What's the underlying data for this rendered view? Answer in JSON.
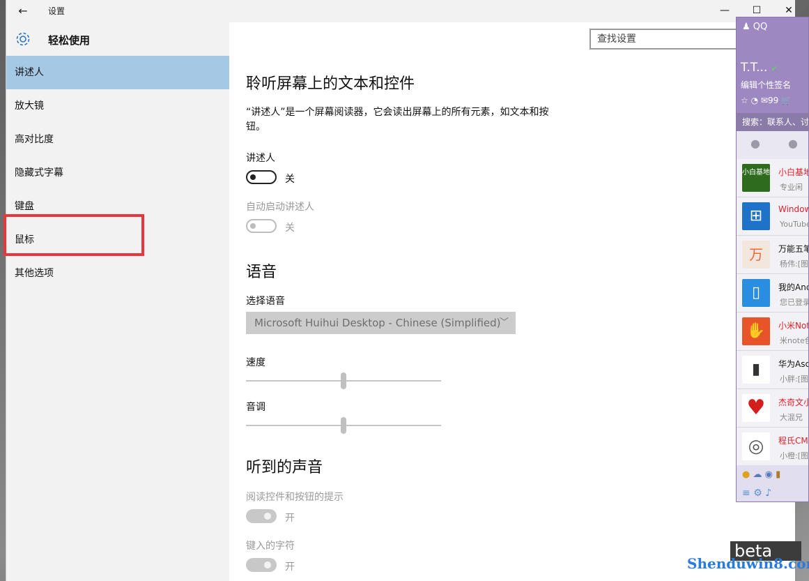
{
  "window": {
    "back_icon": "back-arrow-icon",
    "title": "设置",
    "min_glyph": "—",
    "max_glyph": "☐",
    "close_glyph": "✕"
  },
  "sidebar": {
    "section_title": "轻松使用",
    "items": [
      {
        "label": "讲述人",
        "active": true
      },
      {
        "label": "放大镜"
      },
      {
        "label": "高对比度"
      },
      {
        "label": "隐藏式字幕"
      },
      {
        "label": "键盘"
      },
      {
        "label": "鼠标",
        "highlighted": true
      },
      {
        "label": "其他选项"
      }
    ]
  },
  "search": {
    "placeholder": "查找设置"
  },
  "main": {
    "heading": "聆听屏幕上的文本和控件",
    "description": "“讲述人”是一个屏幕阅读器，它会读出屏幕上的所有元素，如文本和按钮。",
    "narrator_label": "讲述人",
    "narrator_state": "关",
    "autostart_label": "自动启动讲述人",
    "autostart_state": "关",
    "voice_heading": "语音",
    "choose_voice_label": "选择语音",
    "voice_value": "Microsoft Huihui Desktop - Chinese (Simplified)",
    "speed_label": "速度",
    "speed_level": 0.5,
    "pitch_label": "音调",
    "pitch_level": 0.5,
    "sounds_heading": "听到的声音",
    "read_hints_label": "阅读控件和按钮的提示",
    "read_hints_state": "开",
    "typed_chars_label": "键入的字符",
    "typed_chars_state": "开"
  },
  "qq": {
    "logo": "QQ",
    "name": "T.T...",
    "signature": "编辑个性签名",
    "mail_count": "99",
    "search_placeholder": "搜索：联系人、讨",
    "contacts": [
      {
        "name": "小白基地",
        "sub": "专业闲",
        "avatar_text": "小白基地",
        "color": "#2f6b1f",
        "name_color": "#e0202a"
      },
      {
        "name": "Window",
        "sub": "YouTube",
        "avatar_text": "⊞",
        "color": "#1e73c8",
        "name_color": "#e0202a"
      },
      {
        "name": "万能五笔",
        "sub": "杨伟:[图",
        "avatar_text": "万",
        "color": "#e86a3a",
        "name_color": "#111111"
      },
      {
        "name": "我的Andr",
        "sub": "您已登录",
        "avatar_text": "▯",
        "color": "#2a8ee0",
        "name_color": "#111111"
      },
      {
        "name": "小米Note",
        "sub": "米note色",
        "avatar_text": "✋",
        "color": "#e8542a",
        "name_color": "#e0202a"
      },
      {
        "name": "华为Ascen",
        "sub": "小胖:[图",
        "avatar_text": "▮",
        "color": "#cfcfd6",
        "name_color": "#111111"
      },
      {
        "name": "杰奇文小",
        "sub": "大混兄",
        "avatar_text": "♥",
        "color": "#d41e1e",
        "name_color": "#e0202a"
      },
      {
        "name": "程氏CMS",
        "sub": "小橙:[图",
        "avatar_text": "◎",
        "color": "#555555",
        "name_color": "#e0202a"
      }
    ]
  },
  "watermark": {
    "text": "Shenduwin8.com",
    "beta": "beta"
  }
}
